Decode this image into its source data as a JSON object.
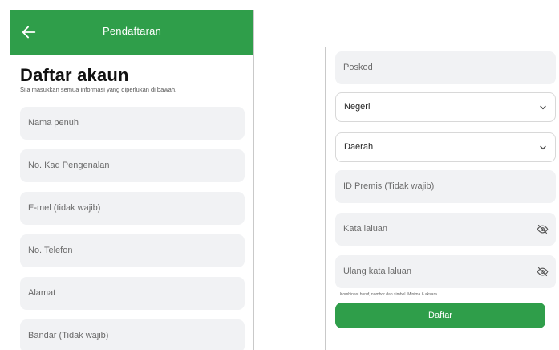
{
  "header": {
    "title": "Pendaftaran",
    "back_icon": "arrow-left-icon"
  },
  "intro": {
    "title": "Daftar akaun",
    "subtitle": "Sila masukkan semua informasi yang diperlukan di bawah."
  },
  "form_left": {
    "full_name": "Nama penuh",
    "ic_number": "No. Kad Pengenalan",
    "email": "E-mel (tidak wajib)",
    "phone": "No. Telefon",
    "address": "Alamat",
    "city": "Bandar (Tidak wajib)"
  },
  "form_right": {
    "postcode": "Poskod",
    "state": "Negeri",
    "district": "Daerah",
    "premise_id": "ID Premis (Tidak wajib)",
    "password": "Kata laluan",
    "confirm_password": "Ulang kata laluan",
    "password_hint": "Kombinasi huruf, nombor dan simbol. Minima 6 aksara.",
    "submit_label": "Daftar"
  },
  "colors": {
    "primary": "#2f9e4a",
    "field_bg": "#f1f2f4",
    "placeholder": "#6b6b6b"
  }
}
